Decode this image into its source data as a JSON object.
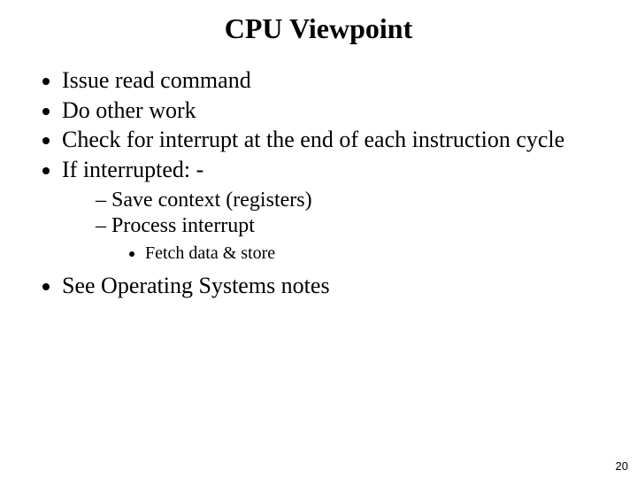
{
  "slide": {
    "title": "CPU Viewpoint",
    "bullets_level1": {
      "b0": "Issue read command",
      "b1": "Do other work",
      "b2": "Check for interrupt at the end of each instruction cycle",
      "b3": "If interrupted: -",
      "b4": "See Operating Systems notes"
    },
    "bullets_level2": {
      "s0": "Save context (registers)",
      "s1": "Process interrupt"
    },
    "bullets_level3": {
      "t0": "Fetch data & store"
    },
    "page_number": "20"
  }
}
